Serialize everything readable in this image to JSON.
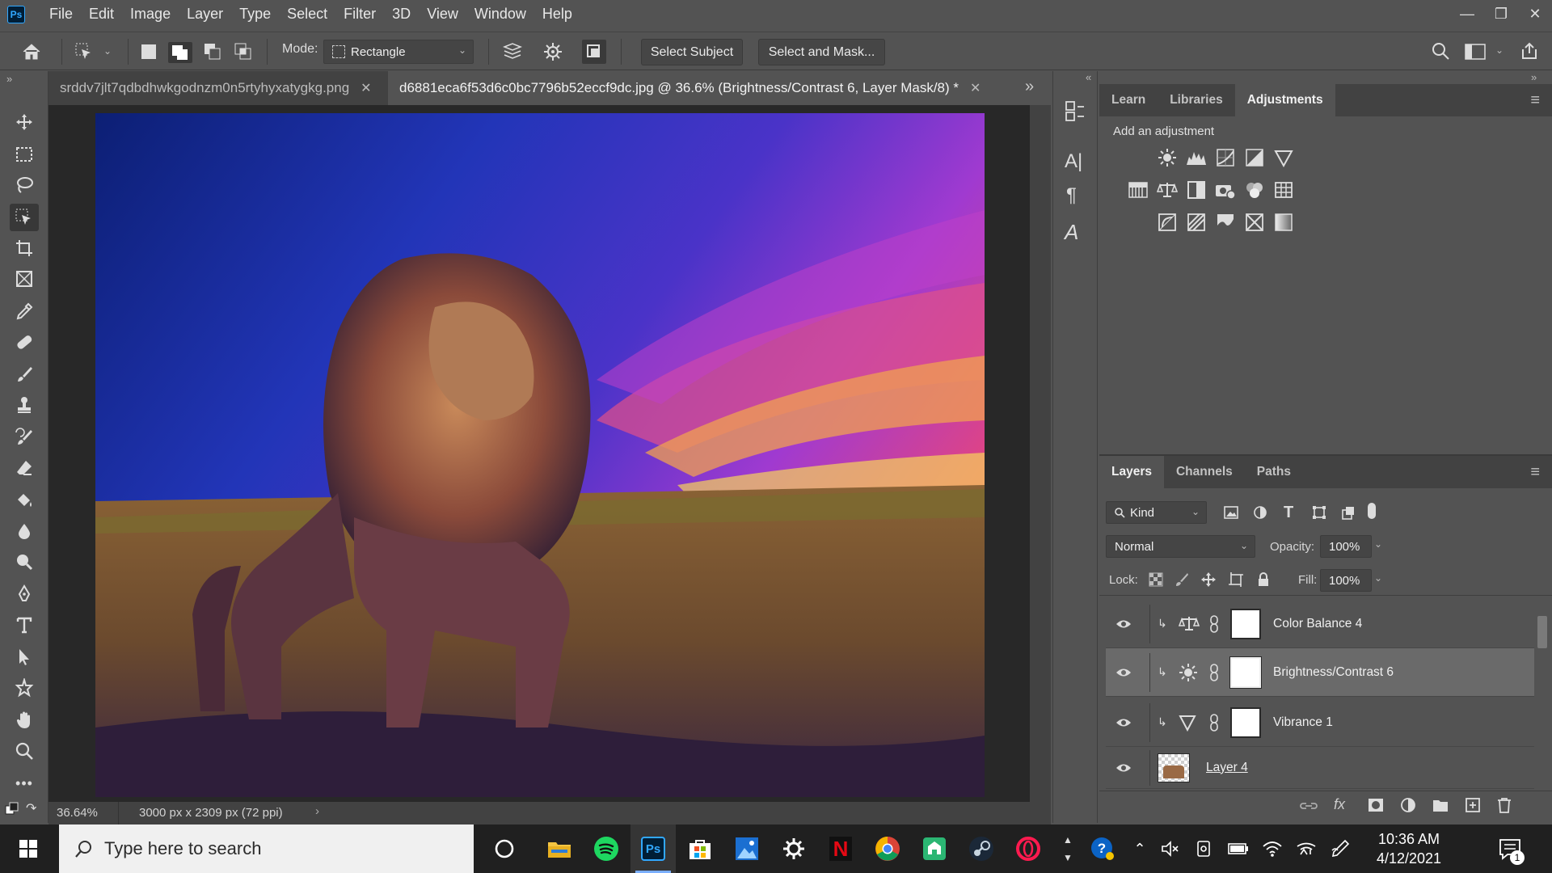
{
  "menu": [
    "File",
    "Edit",
    "Image",
    "Layer",
    "Type",
    "Select",
    "Filter",
    "3D",
    "View",
    "Window",
    "Help"
  ],
  "options": {
    "mode_label": "Mode:",
    "mode_value": "Rectangle",
    "select_subject": "Select Subject",
    "select_and_mask": "Select and Mask..."
  },
  "tabs": [
    {
      "label": "srddv7jlt7qdbdhwkgodnzm0n5rtyhyxatygkg.png",
      "active": false
    },
    {
      "label": "d6881eca6f53d6c0bc7796b52eccf9dc.jpg @ 36.6% (Brightness/Contrast 6, Layer Mask/8) *",
      "active": true
    }
  ],
  "status": {
    "zoom": "36.64%",
    "doc_size": "3000 px x 2309 px (72 ppi)"
  },
  "panels": {
    "top_tabs": [
      "Learn",
      "Libraries",
      "Adjustments"
    ],
    "adjustments_title": "Add an adjustment",
    "layers_tabs": [
      "Layers",
      "Channels",
      "Paths"
    ],
    "filter_kind": "Kind",
    "blend_mode": "Normal",
    "opacity_label": "Opacity:",
    "opacity_value": "100%",
    "lock_label": "Lock:",
    "fill_label": "Fill:",
    "fill_value": "100%",
    "layers": [
      {
        "name": "Color Balance 4",
        "icon": "balance-icon",
        "selected": false
      },
      {
        "name": "Brightness/Contrast 6",
        "icon": "sun-icon",
        "selected": true
      },
      {
        "name": "Vibrance 1",
        "icon": "vibrance-icon",
        "selected": false
      },
      {
        "name": "Layer 4",
        "icon": "image-thumb",
        "selected": false
      }
    ]
  },
  "taskbar": {
    "search_placeholder": "Type here to search",
    "time": "10:36 AM",
    "date": "4/12/2021",
    "notification_count": "1"
  }
}
